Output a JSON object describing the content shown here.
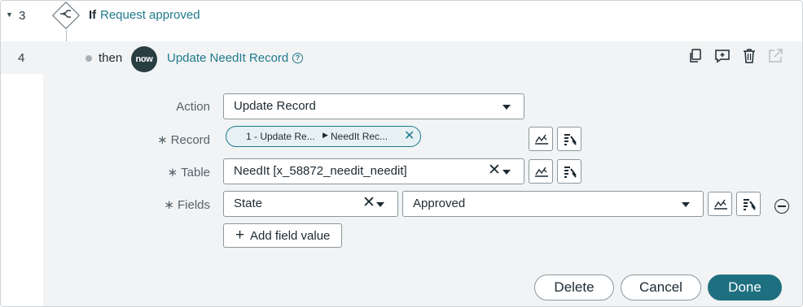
{
  "steps": {
    "if_num": "3",
    "then_num": "4"
  },
  "if_row": {
    "keyword": "If",
    "condition": "Request approved"
  },
  "action_row": {
    "then": "then",
    "logo_text": "now",
    "title": "Update NeedIt Record",
    "help": "?"
  },
  "form": {
    "action_label": "Action",
    "action_value": "Update Record",
    "record_label": "Record",
    "record_pill_part1": "1 - Update Re...",
    "record_pill_part2": "NeedIt Rec...",
    "table_label": "Table",
    "table_value": "NeedIt [x_58872_needit_needit]",
    "fields_label": "Fields",
    "field_name": "State",
    "field_value": "Approved",
    "add_field": "Add field value",
    "required_mark": "∗"
  },
  "footer": {
    "delete": "Delete",
    "cancel": "Cancel",
    "done": "Done"
  },
  "icons": [
    "caret-down-icon",
    "branch-icon",
    "copy-icon",
    "comment-add-icon",
    "trash-icon",
    "external-link-icon",
    "data-pill-picker-icon",
    "script-icon",
    "remove-field-icon",
    "help-icon"
  ],
  "colors": {
    "accent": "#1f7a8c",
    "primary_button": "#1e6f80",
    "panel_bg": "#f1f3f4",
    "logo_bg": "#293e40"
  }
}
